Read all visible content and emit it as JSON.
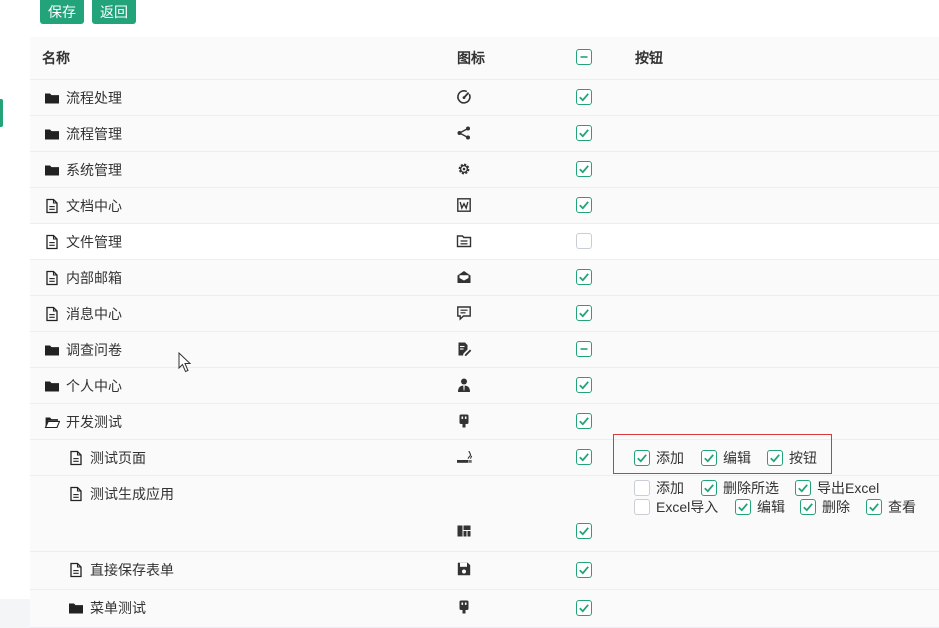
{
  "toolbar": {
    "save_label": "保存",
    "back_label": "返回"
  },
  "header": {
    "name": "名称",
    "icon": "图标",
    "button": "按钮"
  },
  "rows": [
    {
      "label": "流程处理",
      "type": "folder",
      "icon": "gauge-icon",
      "checked": true
    },
    {
      "label": "流程管理",
      "type": "folder",
      "icon": "share-nodes-icon",
      "checked": true
    },
    {
      "label": "系统管理",
      "type": "folder",
      "icon": "gear-icon",
      "checked": true
    },
    {
      "label": "文档中心",
      "type": "file",
      "icon": "word-icon",
      "checked": true
    },
    {
      "label": "文件管理",
      "type": "file",
      "icon": "folder-list-icon",
      "checked": false
    },
    {
      "label": "内部邮箱",
      "type": "file",
      "icon": "mail-open-icon",
      "checked": true
    },
    {
      "label": "消息中心",
      "type": "file",
      "icon": "message-icon",
      "checked": true
    },
    {
      "label": "调查问卷",
      "type": "folder",
      "icon": "file-edit-icon",
      "checked": "partial"
    },
    {
      "label": "个人中心",
      "type": "folder",
      "icon": "user-icon",
      "checked": true
    },
    {
      "label": "开发测试",
      "type": "folder-open",
      "icon": "usb-icon",
      "checked": true
    },
    {
      "label": "测试页面",
      "type": "file",
      "icon": "smoking-icon",
      "checked": true
    },
    {
      "label": "测试生成应用",
      "type": "file",
      "icon": "dashboard-icon",
      "checked": true
    },
    {
      "label": "直接保存表单",
      "type": "file",
      "icon": "save-icon",
      "checked": true
    },
    {
      "label": "菜单测试",
      "type": "folder",
      "icon": "usb-icon",
      "checked": true
    }
  ],
  "buttons_test_page": [
    {
      "label": "添加",
      "checked": true
    },
    {
      "label": "编辑",
      "checked": true
    },
    {
      "label": "按钮",
      "checked": true
    }
  ],
  "buttons_generated_app": [
    {
      "label": "添加",
      "checked": false
    },
    {
      "label": "删除所选",
      "checked": true
    },
    {
      "label": "导出Excel",
      "checked": true
    },
    {
      "label": "Excel导入",
      "checked": false
    },
    {
      "label": "编辑",
      "checked": true
    },
    {
      "label": "删除",
      "checked": true
    },
    {
      "label": "查看",
      "checked": true
    }
  ],
  "colors": {
    "accent": "#22a37a",
    "highlight_border": "#d9363e"
  }
}
